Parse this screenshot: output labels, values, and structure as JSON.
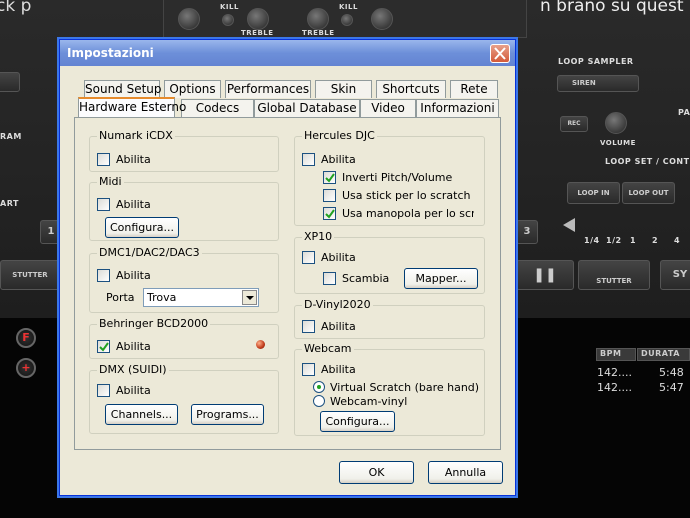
{
  "background": {
    "title_left": "ck p",
    "title_right": "n brano su quest",
    "kill_label": "KILL",
    "treble_label": "TREBLE",
    "loop_sampler_label": "LOOP SAMPLER",
    "siren_value": "SIREN",
    "rec_label": "REC",
    "volume_label": "VOLUME",
    "loop_set_label": "LOOP SET / CONT",
    "loop_in_label": "LOOP IN",
    "loop_out_label": "LOOP OUT",
    "loop_fractions": [
      "1/4",
      "1/2",
      "1",
      "2",
      "4"
    ],
    "stutter_label": "STUTTER",
    "art_label": "ART",
    "ram_label": "RAM",
    "pa_label": "PA",
    "sy_label": "SY",
    "deck_num_left": "1",
    "deck_num_right": "3",
    "list_headers": {
      "bpm": "BPM",
      "durata": "DURATA"
    },
    "list_rows": [
      {
        "bpm": "142....",
        "durata": "5:48"
      },
      {
        "bpm": "142....",
        "durata": "5:47"
      }
    ]
  },
  "dialog": {
    "title": "Impostazioni",
    "tabs_row1": [
      "Sound Setup",
      "Options",
      "Performances",
      "Skin",
      "Shortcuts",
      "Rete"
    ],
    "tabs_row2": [
      "Hardware Esterno",
      "Codecs",
      "Global Database",
      "Video",
      "Informazioni"
    ],
    "selected_tab": "Hardware Esterno",
    "numark": {
      "title": "Numark iCDX",
      "enable_label": "Abilita",
      "enabled": false
    },
    "midi": {
      "title": "Midi",
      "enable_label": "Abilita",
      "enabled": false,
      "configure_label": "Configura..."
    },
    "dmc": {
      "title": "DMC1/DAC2/DAC3",
      "enable_label": "Abilita",
      "enabled": false,
      "port_label": "Porta",
      "port_value": "Trova"
    },
    "behringer": {
      "title": "Behringer BCD2000",
      "enable_label": "Abilita",
      "enabled": true
    },
    "dmx": {
      "title": "DMX (SUIDI)",
      "enable_label": "Abilita",
      "enabled": false,
      "channels_label": "Channels...",
      "programs_label": "Programs..."
    },
    "hercules": {
      "title": "Hercules DJC",
      "enable_label": "Abilita",
      "enabled": false,
      "invert_label": "Inverti Pitch/Volume",
      "invert": true,
      "stick_label": "Usa stick per lo scratch",
      "stick": false,
      "knob_label": "Usa manopola per lo scratcl",
      "knob": true
    },
    "xp10": {
      "title": "XP10",
      "enable_label": "Abilita",
      "enabled": false,
      "swap_label": "Scambia",
      "swap": false,
      "mapper_label": "Mapper..."
    },
    "dvinyl": {
      "title": "D-Vinyl2020",
      "enable_label": "Abilita",
      "enabled": false
    },
    "webcam": {
      "title": "Webcam",
      "enable_label": "Abilita",
      "enabled": false,
      "virtual_label": "Virtual Scratch (bare hand)",
      "vinyl_label": "Webcam-vinyl",
      "selected_mode": "Virtual Scratch (bare hand)",
      "configure_label": "Configura..."
    },
    "ok_label": "OK",
    "cancel_label": "Annulla"
  },
  "colors": {
    "title_bar": "#6d8fd9",
    "dialog_face": "#ece9d8",
    "selected_tab_accent": "#e68b2c",
    "led": "#c03a1a"
  }
}
